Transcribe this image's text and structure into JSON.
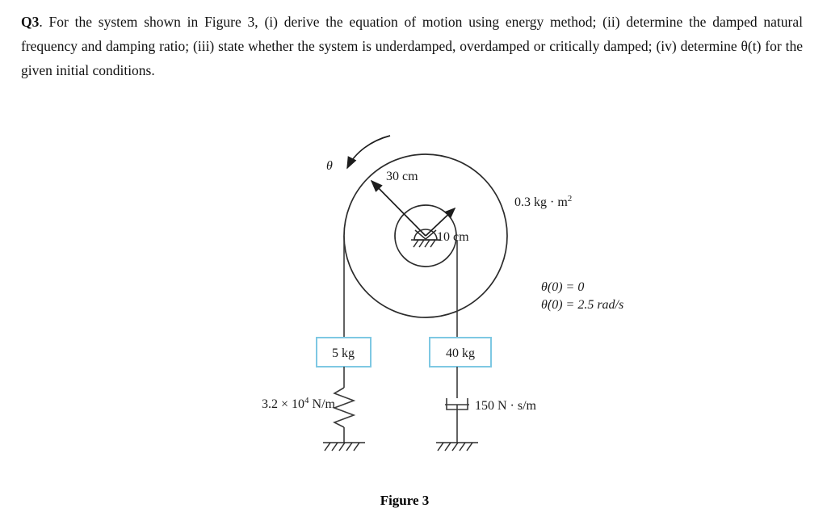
{
  "question": {
    "number": "Q3",
    "text": ". For the system shown in Figure 3, (i) derive the equation of motion using energy method; (ii) determine the damped natural frequency and damping ratio; (iii) state whether the system is underdamped, overdamped or critically damped; (iv) determine θ(t) for the given initial conditions."
  },
  "figure": {
    "caption": "Figure 3",
    "rotation_symbol": "θ",
    "outer_radius_label": "30 cm",
    "inner_radius_label": "10 cm",
    "inertia_value": "0.3 kg · m",
    "inertia_exponent": "2",
    "initial_position": "θ(0) = 0",
    "initial_velocity": "θ̇(0) = 2.5 rad/s",
    "left_mass": "5 kg",
    "right_mass": "40 kg",
    "spring_constant_base": "3.2 × 10",
    "spring_constant_exponent": "4",
    "spring_constant_units": " N/m",
    "damper_label": "150 N · s/m"
  },
  "colors": {
    "box_border": "#7ec8e3",
    "line": "#2b2b2b",
    "text": "#1a1a1a",
    "background": "#ffffff"
  }
}
